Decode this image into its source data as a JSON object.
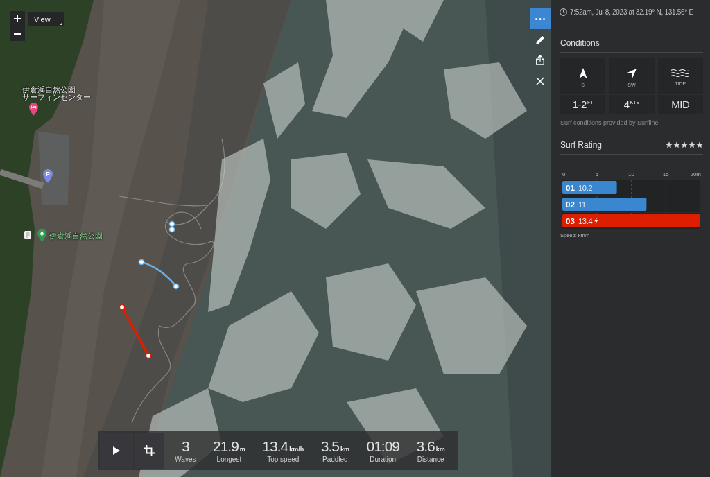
{
  "map": {
    "view_button": "View",
    "pins": [
      {
        "kind": "hotel",
        "color": "#e8467c",
        "label": [
          "伊倉浜自然公園",
          "サーフィンセンター"
        ]
      },
      {
        "kind": "parking",
        "color": "#7a8ce2",
        "text": "P"
      },
      {
        "kind": "marker"
      },
      {
        "kind": "park",
        "color": "#2e9a50",
        "label": [
          "伊倉浜自然公園"
        ]
      }
    ],
    "tracks": [
      {
        "color": "#6aaee6"
      },
      {
        "color": "#6aaee6"
      },
      {
        "color": "#e01d00"
      }
    ]
  },
  "toolbar": [
    {
      "kind": "more",
      "selected": true
    },
    {
      "kind": "edit",
      "selected": false
    },
    {
      "kind": "share",
      "selected": false
    },
    {
      "kind": "close",
      "selected": false
    }
  ],
  "stats_bar": {
    "buttons": [
      {
        "kind": "play"
      },
      {
        "kind": "crop"
      }
    ],
    "stats": [
      {
        "value": "3",
        "label": "Waves"
      },
      {
        "value": "21.9",
        "unit": "m",
        "label": "Longest"
      },
      {
        "value": "13.4",
        "unit": "km/h",
        "label": "Top speed"
      },
      {
        "value": "3.5",
        "unit": "km",
        "label": "Paddled"
      },
      {
        "value": "01:09",
        "label": "Duration"
      },
      {
        "value": "3.6",
        "unit": "km",
        "label": "Distance"
      }
    ]
  },
  "panel": {
    "timestamp": "7:52am, Jul 8, 2023 at 32.19° N, 131.56° E",
    "conditions": {
      "title": "Conditions",
      "items": [
        {
          "kind": "swell",
          "label": "S",
          "value": "1-2$^{FT}$"
        },
        {
          "kind": "wind",
          "label": "SW",
          "value": "4$^{KTS}$"
        },
        {
          "kind": "tide",
          "label": "TIDE",
          "value": "MID"
        }
      ],
      "credit": "Surf conditions provided by Surfline"
    },
    "rating": {
      "title": "Surf Rating",
      "stars": 5
    },
    "chart_data": {
      "type": "bar",
      "orientation": "horizontal",
      "stacked": true,
      "grid": true,
      "categories": [
        "01",
        "02",
        "03"
      ],
      "series": [
        {
          "color": "#3a87cf",
          "values": [
            7.9,
            12.2,
            null
          ]
        },
        {
          "color": "#dd1e00",
          "values": [
            null,
            null,
            20
          ]
        }
      ],
      "xlim": [
        0,
        20
      ],
      "xticks": [
        0,
        5,
        10,
        15,
        {
          "value": 20,
          "label": "20m"
        }
      ],
      "value_labels": [
        "10.2",
        "11",
        "13.4"
      ]
    },
    "chart_note": "Speed: km/h"
  }
}
